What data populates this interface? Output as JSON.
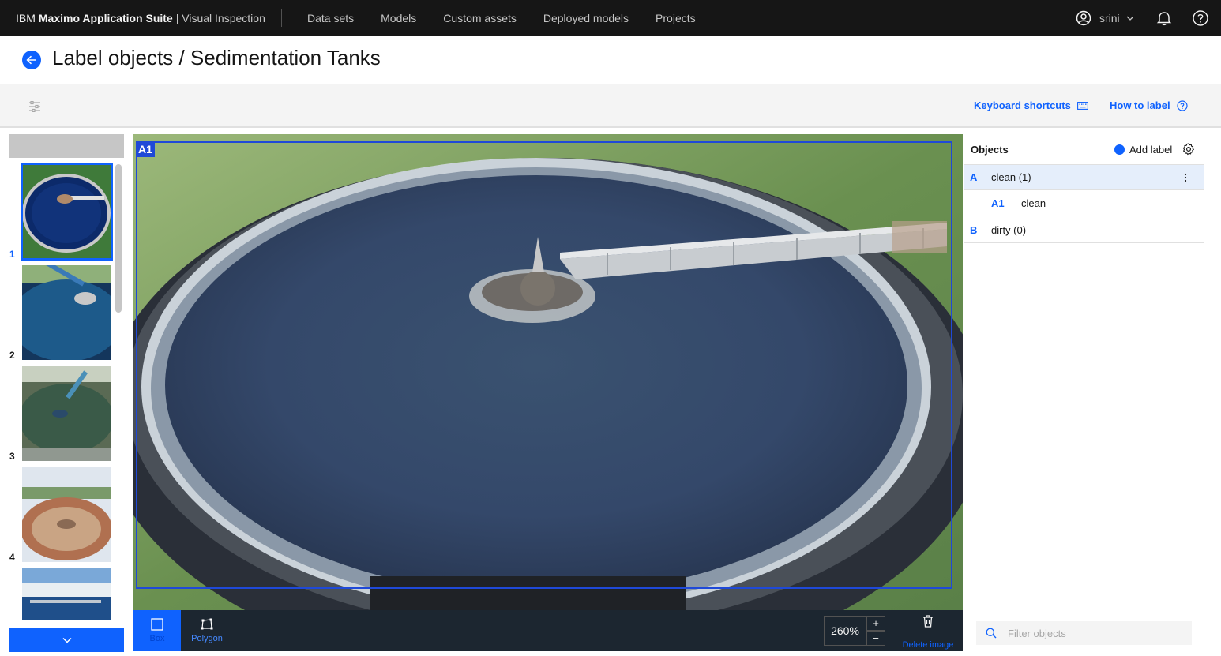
{
  "topnav": {
    "brand_prefix": "IBM",
    "brand_product": "Maximo Application Suite",
    "brand_app": "| Visual Inspection",
    "links": [
      "Data sets",
      "Models",
      "Custom assets",
      "Deployed models",
      "Projects"
    ],
    "user_name": "srini"
  },
  "page": {
    "title": "Label objects / Sedimentation Tanks"
  },
  "toolbar": {
    "keyboard_shortcuts": "Keyboard shortcuts",
    "how_to_label": "How to label"
  },
  "thumbnails": [
    {
      "number": "1",
      "selected": true
    },
    {
      "number": "2",
      "selected": false
    },
    {
      "number": "3",
      "selected": false
    },
    {
      "number": "4",
      "selected": false
    },
    {
      "number": "",
      "selected": false
    }
  ],
  "canvas": {
    "box_tag": "A1"
  },
  "tools": {
    "box_label": "Box",
    "polygon_label": "Polygon",
    "zoom": "260%",
    "zoom_in": "+",
    "zoom_out": "−",
    "delete_image": "Delete image"
  },
  "objects_panel": {
    "title": "Objects",
    "add_label": "Add label",
    "labels": [
      {
        "letter": "A",
        "name": "clean (1)",
        "instances": [
          {
            "id": "A1",
            "name": "clean"
          }
        ]
      },
      {
        "letter": "B",
        "name": "dirty (0)",
        "instances": []
      }
    ],
    "filter_placeholder": "Filter objects"
  },
  "colors": {
    "accent": "#0f62fe",
    "nav_bg": "#161616",
    "box_stroke": "#1f49d8"
  }
}
